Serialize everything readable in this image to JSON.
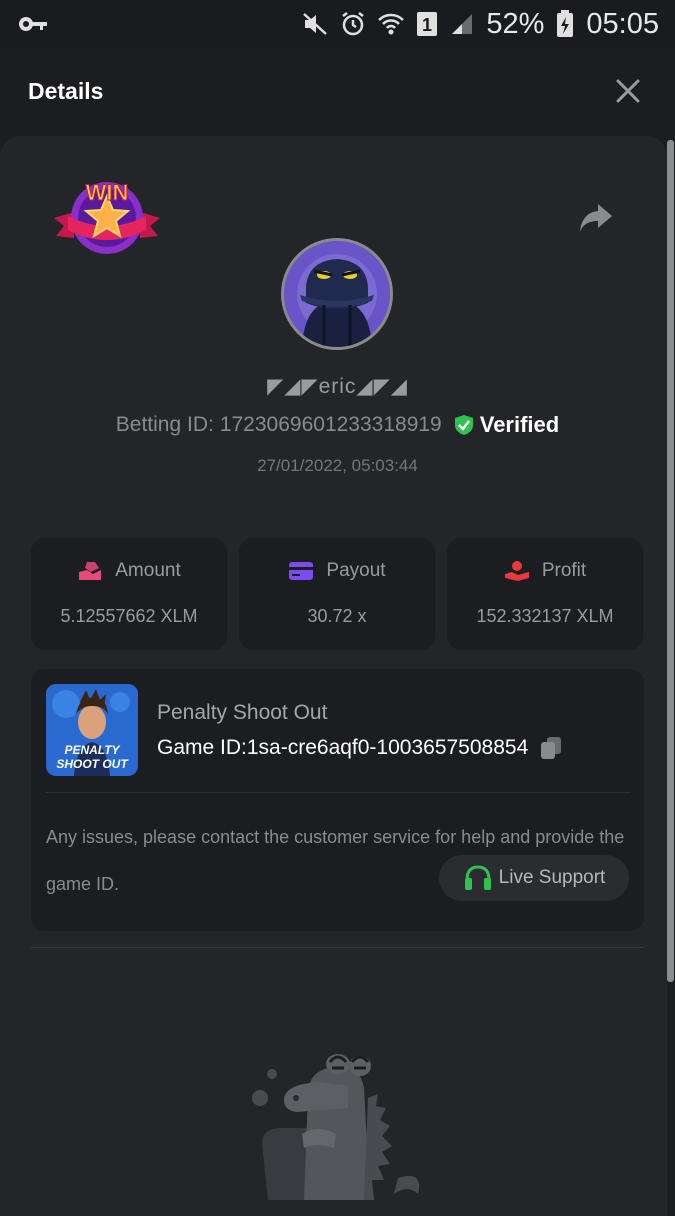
{
  "status_bar": {
    "battery": "52%",
    "time": "05:05",
    "sim_slot": "1"
  },
  "header": {
    "title": "Details"
  },
  "bet": {
    "username": "◤◢◤eric◢◤◢",
    "betting_id_label": "Betting ID:",
    "betting_id": "1723069601233318919",
    "verified_label": "Verified",
    "timestamp": "27/01/2022, 05:03:44",
    "badge_text": "WIN"
  },
  "stats": [
    {
      "label": "Amount",
      "value": "5.12557662 XLM",
      "icon": "coin-hand-icon"
    },
    {
      "label": "Payout",
      "value": "30.72 x",
      "icon": "card-icon"
    },
    {
      "label": "Profit",
      "value": "152.332137 XLM",
      "icon": "hand-coin-icon"
    }
  ],
  "game": {
    "name": "Penalty Shoot Out",
    "id_label": "Game ID:",
    "id": "1sa-cre6aqf0-1003657508854",
    "thumb_title_line1": "PENALTY",
    "thumb_title_line2": "SHOOT OUT",
    "help_text": "Any issues, please contact the customer service for help and provide the game ID.",
    "support_label": "Live Support"
  },
  "colors": {
    "background": "#1c1d20",
    "panel": "#242529",
    "verified_green": "#2ec24f",
    "amount_pink": "#e84a7a",
    "payout_purple": "#7b4cf0",
    "profit_red": "#e83a3a",
    "support_green": "#2ec24f"
  }
}
